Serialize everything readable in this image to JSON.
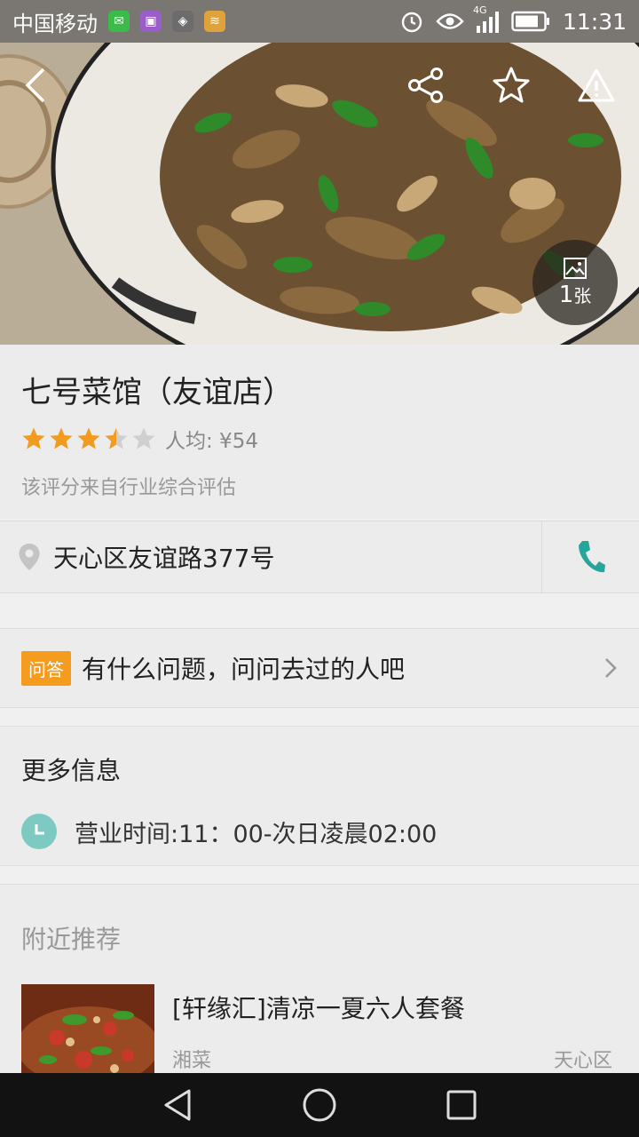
{
  "status_bar": {
    "carrier": "中国移动",
    "network": "4G",
    "time": "11:31"
  },
  "hero": {
    "photo_count_num": "1",
    "photo_count_unit": "张"
  },
  "restaurant": {
    "name": "七号菜馆（友谊店）",
    "rating": 3.5,
    "rating_max": 5,
    "avg_price_label": "人均: ¥54",
    "rating_note": "该评分来自行业综合评估",
    "address": "天心区友谊路377号"
  },
  "qa": {
    "badge": "问答",
    "prompt": "有什么问题，问问去过的人吧"
  },
  "more_info": {
    "title": "更多信息",
    "hours": "营业时间:11：00-次日凌晨02:00"
  },
  "nearby": {
    "title": "附近推荐",
    "items": [
      {
        "name": "[轩缘汇]清凉一夏六人套餐",
        "cuisine": "湘菜",
        "area": "天心区"
      }
    ]
  },
  "colors": {
    "star": "#f29c1f",
    "star_empty": "#cfcfcf",
    "accent_teal": "#26a69a",
    "qa_badge": "#f59b1e"
  },
  "icons": [
    "back-icon",
    "share-icon",
    "star-icon",
    "warning-icon",
    "image-icon",
    "location-icon",
    "phone-icon",
    "chevron-right-icon",
    "clock-icon"
  ]
}
